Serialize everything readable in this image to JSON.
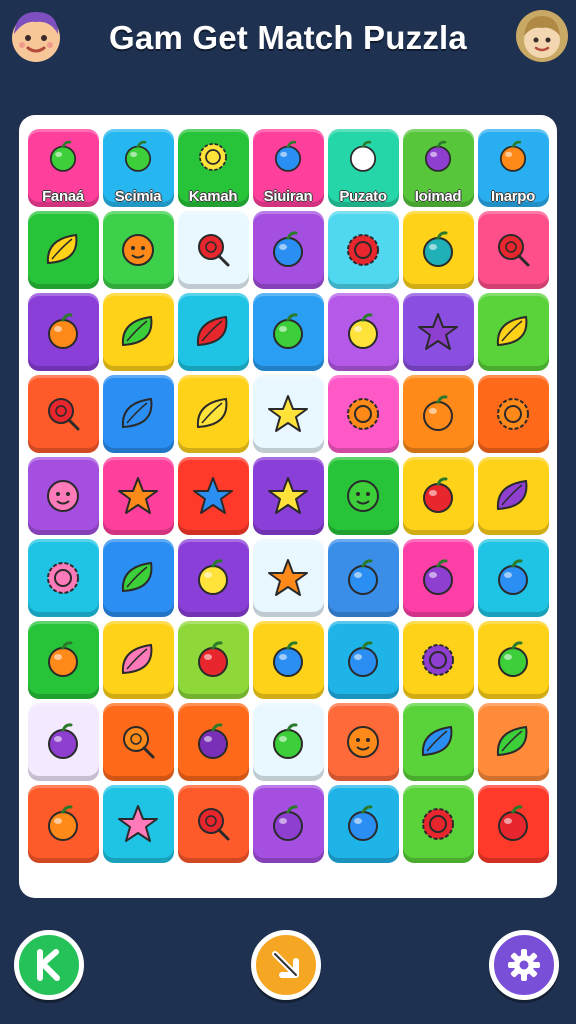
{
  "header": {
    "title": "Gam Get Match Puzzla",
    "left_avatar": "player-avatar-purple-hair",
    "right_avatar": "opponent-avatar-blonde"
  },
  "board": {
    "label_row": [
      {
        "label": "Fanaá",
        "color": "#ff3f9c",
        "icon": "green-ring-icon"
      },
      {
        "label": "Scimia",
        "color": "#26b7f0",
        "icon": "green-ring-icon"
      },
      {
        "label": "Kamah",
        "color": "#27c43a",
        "icon": "yellow-flower-icon"
      },
      {
        "label": "Siuiran",
        "color": "#ff3f9c",
        "icon": "blue-ball-icon"
      },
      {
        "label": "Puzato",
        "color": "#25d6a8",
        "icon": "white-swirl-icon"
      },
      {
        "label": "Ioimad",
        "color": "#57c63a",
        "icon": "purple-berry-icon"
      },
      {
        "label": "Inarpo",
        "color": "#2aaef2",
        "icon": "striped-ball-icon"
      }
    ],
    "rows": [
      [
        {
          "color": "#27c43a",
          "icon": "banana"
        },
        {
          "color": "#3dd04a",
          "icon": "orange-face"
        },
        {
          "color": "#e9f7ff",
          "icon": "red-cherry"
        },
        {
          "color": "#a44fe0",
          "icon": "blue-blob"
        },
        {
          "color": "#4fd8f0",
          "icon": "red-gear"
        },
        {
          "color": "#ffd21a",
          "icon": "teal-orb"
        },
        {
          "color": "#ff4f8a",
          "icon": "red-lollipop"
        }
      ],
      [
        {
          "color": "#8a3fd8",
          "icon": "orange-candy"
        },
        {
          "color": "#ffd21a",
          "icon": "green-leaf"
        },
        {
          "color": "#1fc4e4",
          "icon": "red-pepper"
        },
        {
          "color": "#2a9ef2",
          "icon": "green-gem"
        },
        {
          "color": "#b55ae8",
          "icon": "yellow-lemon"
        },
        {
          "color": "#8a4fe0",
          "icon": "purple-star"
        },
        {
          "color": "#5ad23a",
          "icon": "mango"
        }
      ],
      [
        {
          "color": "#ff5a2a",
          "icon": "red-lollipop"
        },
        {
          "color": "#2a8ef2",
          "icon": "blue-crystal"
        },
        {
          "color": "#ffd21a",
          "icon": "yellow-pepper"
        },
        {
          "color": "#e9f7ff",
          "icon": "yellow-star"
        },
        {
          "color": "#ff59c8",
          "icon": "sun-face"
        },
        {
          "color": "#ff8a1a",
          "icon": "orange-swirl"
        },
        {
          "color": "#ff6a1a",
          "icon": "orange-sun"
        }
      ],
      [
        {
          "color": "#a44fe0",
          "icon": "pink-face"
        },
        {
          "color": "#ff3f9c",
          "icon": "orange-star"
        },
        {
          "color": "#ff3a2a",
          "icon": "blue-star"
        },
        {
          "color": "#8a3fd8",
          "icon": "yellow-star-face"
        },
        {
          "color": "#27c43a",
          "icon": "green-face"
        },
        {
          "color": "#ffd21a",
          "icon": "red-flame"
        },
        {
          "color": "#ffd21a",
          "icon": "purple-radish"
        }
      ],
      [
        {
          "color": "#1fc4e4",
          "icon": "pink-flower"
        },
        {
          "color": "#2a8ef2",
          "icon": "green-leaf"
        },
        {
          "color": "#8a3fd8",
          "icon": "yellow-lemon"
        },
        {
          "color": "#e9f7ff",
          "icon": "orange-star"
        },
        {
          "color": "#3a8ee8",
          "icon": "blue-shell"
        },
        {
          "color": "#ff3fa8",
          "icon": "purple-berry"
        },
        {
          "color": "#1fc4e4",
          "icon": "blue-orb"
        }
      ],
      [
        {
          "color": "#27c43a",
          "icon": "orange-coin"
        },
        {
          "color": "#ffd21a",
          "icon": "pink-leaf"
        },
        {
          "color": "#8ed83a",
          "icon": "strawberry"
        },
        {
          "color": "#ffd21a",
          "icon": "blue-egg"
        },
        {
          "color": "#1fb4e8",
          "icon": "blue-apple"
        },
        {
          "color": "#ffd21a",
          "icon": "purple-gear"
        },
        {
          "color": "#ffd21a",
          "icon": "green-strawberry"
        }
      ],
      [
        {
          "color": "#f3eaff",
          "icon": "purple-berry"
        },
        {
          "color": "#ff6a1a",
          "icon": "orange-lollipop"
        },
        {
          "color": "#ff6a1a",
          "icon": "eggplant"
        },
        {
          "color": "#e9f7ff",
          "icon": "green-orb"
        },
        {
          "color": "#ff6a3a",
          "icon": "orange-face"
        },
        {
          "color": "#5ad23a",
          "icon": "blue-leaf"
        },
        {
          "color": "#ff8a3a",
          "icon": "green-leaf"
        }
      ],
      [
        {
          "color": "#ff5a2a",
          "icon": "orange-shell"
        },
        {
          "color": "#1fc4e4",
          "icon": "pink-star"
        },
        {
          "color": "#ff5a2a",
          "icon": "red-lollipop"
        },
        {
          "color": "#a44fe0",
          "icon": "purple-ball"
        },
        {
          "color": "#1fb4e8",
          "icon": "blue-apple"
        },
        {
          "color": "#5ad23a",
          "icon": "red-flower"
        },
        {
          "color": "#ff3a2a",
          "icon": "red-striped-ball"
        }
      ]
    ]
  },
  "controls": {
    "back_icon": "letter-k-back-icon",
    "hint_icon": "diagonal-arrow-icon",
    "settings_icon": "gear-icon"
  }
}
